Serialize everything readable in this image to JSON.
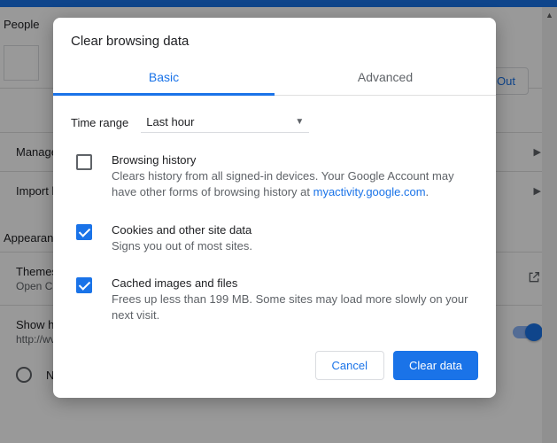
{
  "bg": {
    "section_people": "People",
    "signout": "n Out",
    "manage_row": "Manage b",
    "import_row": "Import b",
    "section_appearance": "Appearance",
    "themes_title": "Themes",
    "themes_sub": "Open Ch",
    "showhome_title": "Show ho",
    "showhome_sub": "http://wv",
    "newtab": "New Tab page"
  },
  "dialog": {
    "title": "Clear browsing data",
    "tab_basic": "Basic",
    "tab_advanced": "Advanced",
    "time_label": "Time range",
    "time_value": "Last hour",
    "opts": [
      {
        "title": "Browsing history",
        "desc_pre": "Clears history from all signed-in devices. Your Google Account may have other forms of browsing history at ",
        "link": "myactivity.google.com",
        "desc_post": ".",
        "checked": false
      },
      {
        "title": "Cookies and other site data",
        "desc": "Signs you out of most sites.",
        "checked": true
      },
      {
        "title": "Cached images and files",
        "desc": "Frees up less than 199 MB. Some sites may load more slowly on your next visit.",
        "checked": true
      }
    ],
    "cancel": "Cancel",
    "confirm": "Clear data"
  }
}
